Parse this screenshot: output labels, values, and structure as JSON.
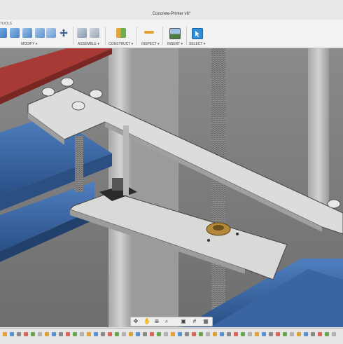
{
  "window": {
    "title": "Concrete-Printer v6*"
  },
  "toolbar": {
    "tools_label": "TOOLS",
    "groups": [
      {
        "label": "MODIFY ▾"
      },
      {
        "label": "ASSEMBLE ▾"
      },
      {
        "label": "CONSTRUCT ▾"
      },
      {
        "label": "INSPECT ▾"
      },
      {
        "label": "INSERT ▾"
      },
      {
        "label": "SELECT ▾"
      }
    ]
  },
  "nav": {
    "orbit": "✥",
    "pan": "✋",
    "zoom": "⊕",
    "fit": "⌕",
    "display": "▣",
    "grid": "#",
    "viewports": "▦"
  },
  "colors": {
    "beam_blue": "#3f6fae",
    "beam_red": "#b0403c",
    "plate": "#d9d9d7",
    "nut_bronze": "#b48a3a",
    "select_blue": "#2f8fd8"
  }
}
